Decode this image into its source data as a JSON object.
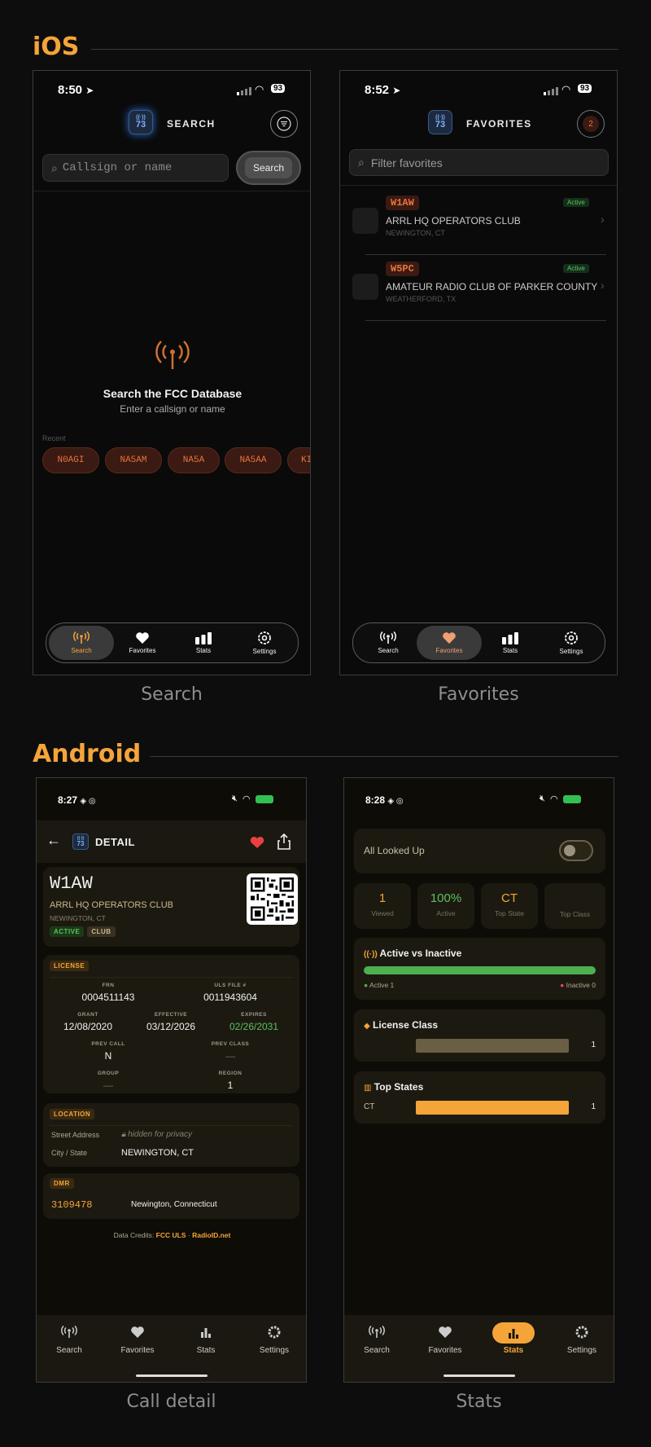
{
  "sections": {
    "ios": "iOS",
    "android": "Android"
  },
  "captions": {
    "search": "Search",
    "favorites": "Favorites",
    "detail": "Call detail",
    "stats": "Stats"
  },
  "ios_search": {
    "time": "8:50",
    "battery": "93",
    "app_icon_text": "73",
    "title": "SEARCH",
    "placeholder": "Callsign or name",
    "search_button": "Search",
    "empty_title": "Search the FCC Database",
    "empty_subtitle": "Enter a callsign or name",
    "recent_label": "Recent",
    "recent": [
      "N0AGI",
      "NA5AM",
      "NA5A",
      "NA5AA",
      "KI"
    ]
  },
  "ios_favorites": {
    "time": "8:52",
    "battery": "93",
    "app_icon_text": "73",
    "title": "FAVORITES",
    "count_badge": "2",
    "filter_placeholder": "Filter favorites",
    "items": [
      {
        "callsign": "W1AW",
        "name": "ARRL HQ OPERATORS CLUB",
        "location": "NEWINGTON, CT",
        "status": "Active"
      },
      {
        "callsign": "W5PC",
        "name": "AMATEUR RADIO CLUB OF PARKER COUNTY",
        "location": "WEATHERFORD, TX",
        "status": "Active"
      }
    ]
  },
  "ios_tabs": [
    "Search",
    "Favorites",
    "Stats",
    "Settings"
  ],
  "android_detail": {
    "time": "8:27",
    "header_title": "DETAIL",
    "app_icon_text": "73",
    "callsign": "W1AW",
    "name": "ARRL HQ OPERATORS CLUB",
    "location": "NEWINGTON, CT",
    "tags": [
      "ACTIVE",
      "CLUB"
    ],
    "license": {
      "section_label": "LICENSE",
      "frn_label": "FRN",
      "frn": "0004511143",
      "uls_label": "ULS FILE #",
      "uls": "0011943604",
      "grant_label": "GRANT",
      "grant": "12/08/2020",
      "effective_label": "EFFECTIVE",
      "effective": "03/12/2026",
      "expires_label": "EXPIRES",
      "expires": "02/26/2031",
      "prev_call_label": "PREV CALL",
      "prev_call": "N",
      "prev_class_label": "PREV CLASS",
      "prev_class": "—",
      "group_label": "GROUP",
      "group": "—",
      "region_label": "REGION",
      "region": "1"
    },
    "location_section": {
      "section_label": "LOCATION",
      "street_label": "Street Address",
      "street_value": "hidden for privacy",
      "city_label": "City / State",
      "city_value": "NEWINGTON, CT"
    },
    "dmr": {
      "section_label": "DMR",
      "id": "3109478",
      "place": "Newington, Connecticut"
    },
    "credits_prefix": "Data Credits:",
    "credit_1": "FCC ULS",
    "credit_sep": "·",
    "credit_2": "RadioID.net"
  },
  "android_stats": {
    "time": "8:28",
    "toggle_label": "All Looked Up",
    "boxes": [
      {
        "value": "1",
        "label": "Viewed"
      },
      {
        "value": "100%",
        "label": "Active"
      },
      {
        "value": "CT",
        "label": "Top State"
      },
      {
        "value": "",
        "label": "Top Class"
      }
    ],
    "active_card": {
      "title": "Active vs Inactive",
      "active_label": "Active 1",
      "inactive_label": "Inactive 0",
      "active_fraction": 1.0
    },
    "class_card": {
      "title": "License Class",
      "count": "1",
      "fraction": 1.0
    },
    "states_card": {
      "title": "Top States",
      "state": "CT",
      "count": "1",
      "fraction": 1.0
    }
  },
  "android_tabs": [
    "Search",
    "Favorites",
    "Stats",
    "Settings"
  ],
  "colors": {
    "accent": "#f5a43a",
    "callsign": "#e8753a",
    "active_green": "#4caf50",
    "inactive_red": "#e05050",
    "heart": "#e84040"
  }
}
